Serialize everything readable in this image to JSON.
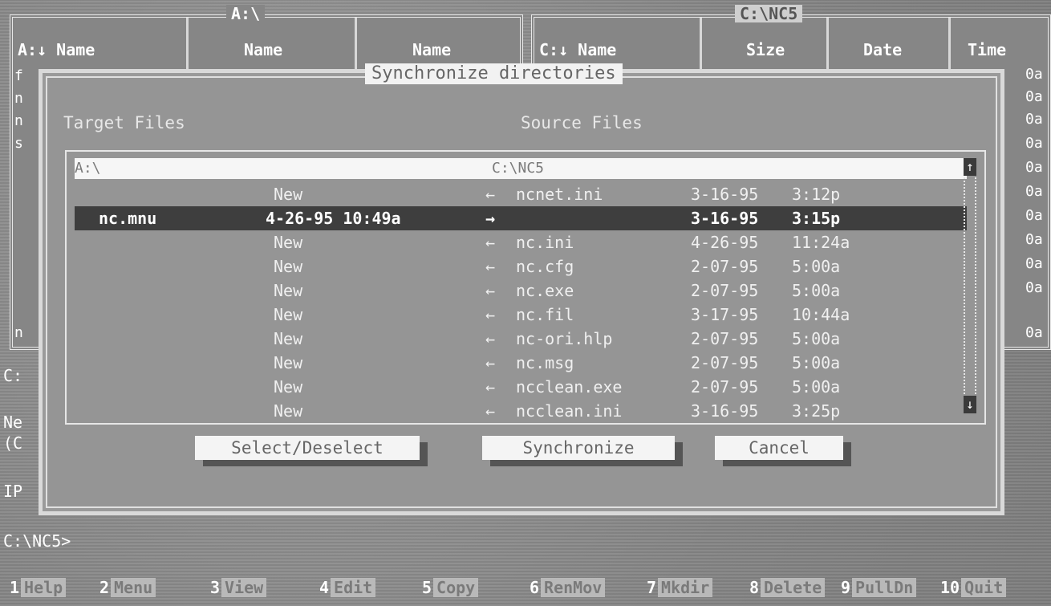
{
  "left_panel": {
    "title": "A:\\",
    "headers": [
      "A:↓ Name",
      "Name",
      "Name"
    ],
    "edge_rows": [
      "f",
      "n",
      "n",
      "s",
      "n"
    ]
  },
  "right_panel": {
    "title": "C:\\NC5",
    "headers": [
      "C:↓ Name",
      "Size",
      "Date",
      "Time"
    ],
    "edge_times": [
      "0a",
      "0a",
      "0a",
      "0a",
      "0a",
      "0a",
      "0a",
      "0a",
      "0a",
      "0a",
      "0a"
    ]
  },
  "dialog": {
    "title": "Synchronize directories",
    "target_label": "Target Files",
    "source_label": "Source Files",
    "target_path": "A:\\",
    "source_path": "C:\\NC5",
    "rows": [
      {
        "target_name": "",
        "target_info": "New",
        "arrow": "←",
        "source_name": "ncnet.ini",
        "date": "3-16-95",
        "time": "3:12p",
        "highlight": false
      },
      {
        "target_name": "nc.mnu",
        "target_info": "4-26-95 10:49a",
        "arrow": "→",
        "source_name": "",
        "date": "3-16-95",
        "time": "3:15p",
        "highlight": true
      },
      {
        "target_name": "",
        "target_info": "New",
        "arrow": "←",
        "source_name": "nc.ini",
        "date": "4-26-95",
        "time": "11:24a",
        "highlight": false
      },
      {
        "target_name": "",
        "target_info": "New",
        "arrow": "←",
        "source_name": "nc.cfg",
        "date": "2-07-95",
        "time": "5:00a",
        "highlight": false
      },
      {
        "target_name": "",
        "target_info": "New",
        "arrow": "←",
        "source_name": "nc.exe",
        "date": "2-07-95",
        "time": "5:00a",
        "highlight": false
      },
      {
        "target_name": "",
        "target_info": "New",
        "arrow": "←",
        "source_name": "nc.fil",
        "date": "3-17-95",
        "time": "10:44a",
        "highlight": false
      },
      {
        "target_name": "",
        "target_info": "New",
        "arrow": "←",
        "source_name": "nc-ori.hlp",
        "date": "2-07-95",
        "time": "5:00a",
        "highlight": false
      },
      {
        "target_name": "",
        "target_info": "New",
        "arrow": "←",
        "source_name": "nc.msg",
        "date": "2-07-95",
        "time": "5:00a",
        "highlight": false
      },
      {
        "target_name": "",
        "target_info": "New",
        "arrow": "←",
        "source_name": "ncclean.exe",
        "date": "2-07-95",
        "time": "5:00a",
        "highlight": false
      },
      {
        "target_name": "",
        "target_info": "New",
        "arrow": "←",
        "source_name": "ncclean.ini",
        "date": "3-16-95",
        "time": "3:25p",
        "highlight": false
      }
    ],
    "scroll_up": "↑",
    "scroll_down": "↓",
    "buttons": {
      "select": "Select/Deselect",
      "synchronize": "Synchronize",
      "cancel": "Cancel"
    }
  },
  "background_lines": [
    "C:",
    "Ne",
    "(C",
    "IP"
  ],
  "prompt": "C:\\NC5>",
  "function_keys": [
    {
      "num": "1",
      "label": "Help"
    },
    {
      "num": "2",
      "label": "Menu"
    },
    {
      "num": "3",
      "label": "View"
    },
    {
      "num": "4",
      "label": "Edit"
    },
    {
      "num": "5",
      "label": "Copy"
    },
    {
      "num": "6",
      "label": "RenMov"
    },
    {
      "num": "7",
      "label": "Mkdir"
    },
    {
      "num": "8",
      "label": "Delete"
    },
    {
      "num": "9",
      "label": "PullDn"
    },
    {
      "num": "10",
      "label": "Quit"
    }
  ]
}
